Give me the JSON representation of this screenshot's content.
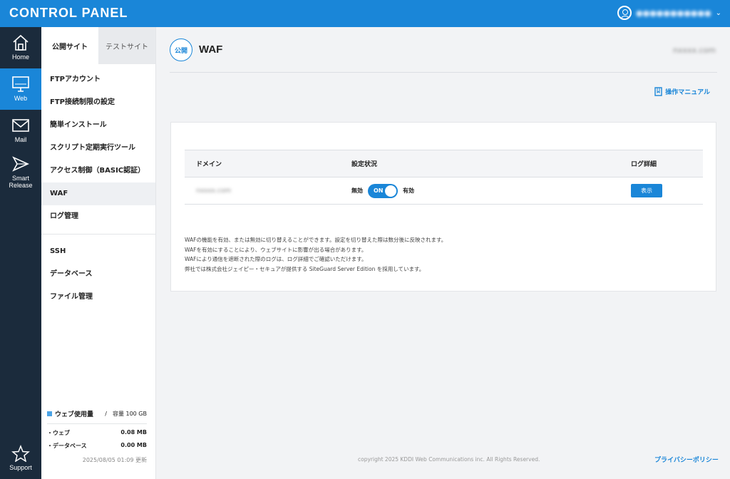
{
  "header": {
    "brand": "CONTROL PANEL",
    "user_name": "●●●●●●●●●●●",
    "dropdown_icon": "chevron-down-icon"
  },
  "leftnav": {
    "items": [
      {
        "label": "Home",
        "icon": "home-icon"
      },
      {
        "label": "Web",
        "icon": "monitor-icon"
      },
      {
        "label": "Mail",
        "icon": "mail-icon"
      },
      {
        "label": "Smart",
        "label2": "Release",
        "icon": "arrow-release-icon"
      },
      {
        "label": "Support",
        "icon": "star-icon"
      }
    ]
  },
  "subnav": {
    "tabs": [
      {
        "label": "公開サイト"
      },
      {
        "label": "テストサイト"
      }
    ],
    "menu": [
      "FTPアカウント",
      "FTP接続制限の設定",
      "簡単インストール",
      "スクリプト定期実行ツール",
      "アクセス制御（BASIC認証）",
      "WAF",
      "ログ管理"
    ],
    "menu2": [
      "SSH",
      "データベース",
      "ファイル管理"
    ],
    "usage": {
      "title": "ウェブ使用量",
      "capacity": "/　容量 100 GB",
      "rows": [
        {
          "label": "・ウェブ",
          "value": "0.08 MB"
        },
        {
          "label": "・データベース",
          "value": "0.00 MB"
        }
      ],
      "updated": "2025/08/05 01:09 更新"
    }
  },
  "main": {
    "badge": "公開",
    "title": "WAF",
    "domain": "nxxxx.com",
    "manual_link": "操作マニュアル",
    "table": {
      "headers": [
        "ドメイン",
        "設定状況",
        "ログ詳細"
      ],
      "row": {
        "domain": "nxxxx.com",
        "off_label": "無効",
        "toggle_label": "ON",
        "on_label": "有効",
        "button": "表示"
      }
    },
    "notes": [
      "WAFの機能を有効、または無効に切り替えることができます。設定を切り替えた際は数分後に反映されます。",
      "WAFを有効にすることにより、ウェブサイトに影響が出る場合があります。",
      "WAFにより通信を遮断された際のログは、ログ詳細でご確認いただけます。",
      "弊社では株式会社ジェイピー・セキュアが提供する SiteGuard Server Edition を採用しています。"
    ]
  },
  "footer": {
    "copyright": "copyright 2025 KDDI Web Communications inc. All Rights Reserved.",
    "privacy": "プライバシーポリシー"
  },
  "colors": {
    "accent": "#1a86d8",
    "sidebar": "#1b2b3c",
    "background": "#f2f3f5"
  }
}
